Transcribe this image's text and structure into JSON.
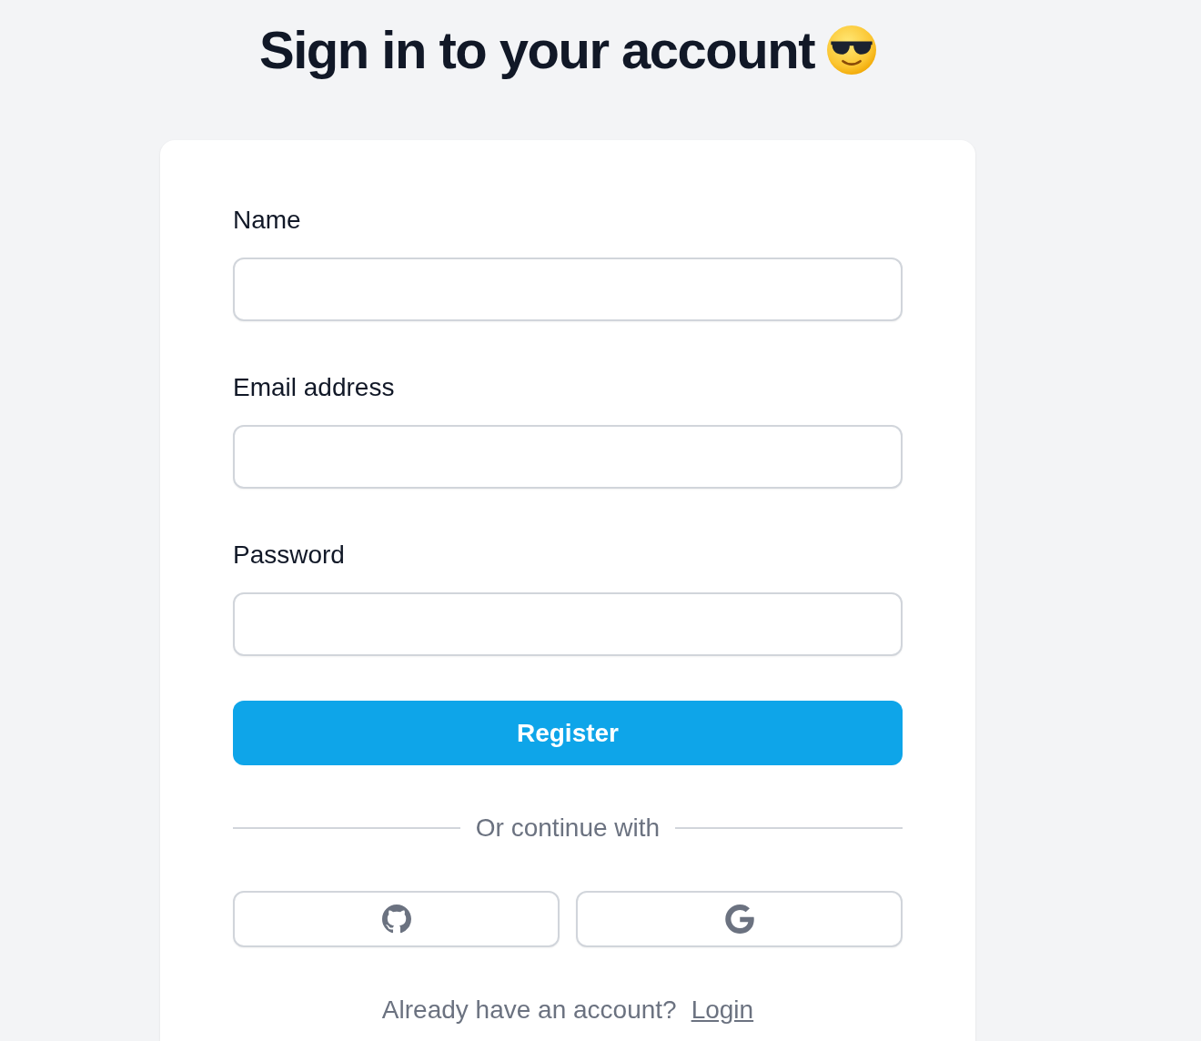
{
  "heading": {
    "title": "Sign in to your account"
  },
  "form": {
    "fields": [
      {
        "label": "Name"
      },
      {
        "label": "Email address"
      },
      {
        "label": "Password"
      }
    ],
    "submit_button": "Register",
    "divider_text": "Or continue with",
    "social_buttons": [
      {
        "kind": "github"
      },
      {
        "kind": "google"
      }
    ],
    "footer": {
      "prompt": "Already have an account?",
      "link": "Login"
    }
  }
}
